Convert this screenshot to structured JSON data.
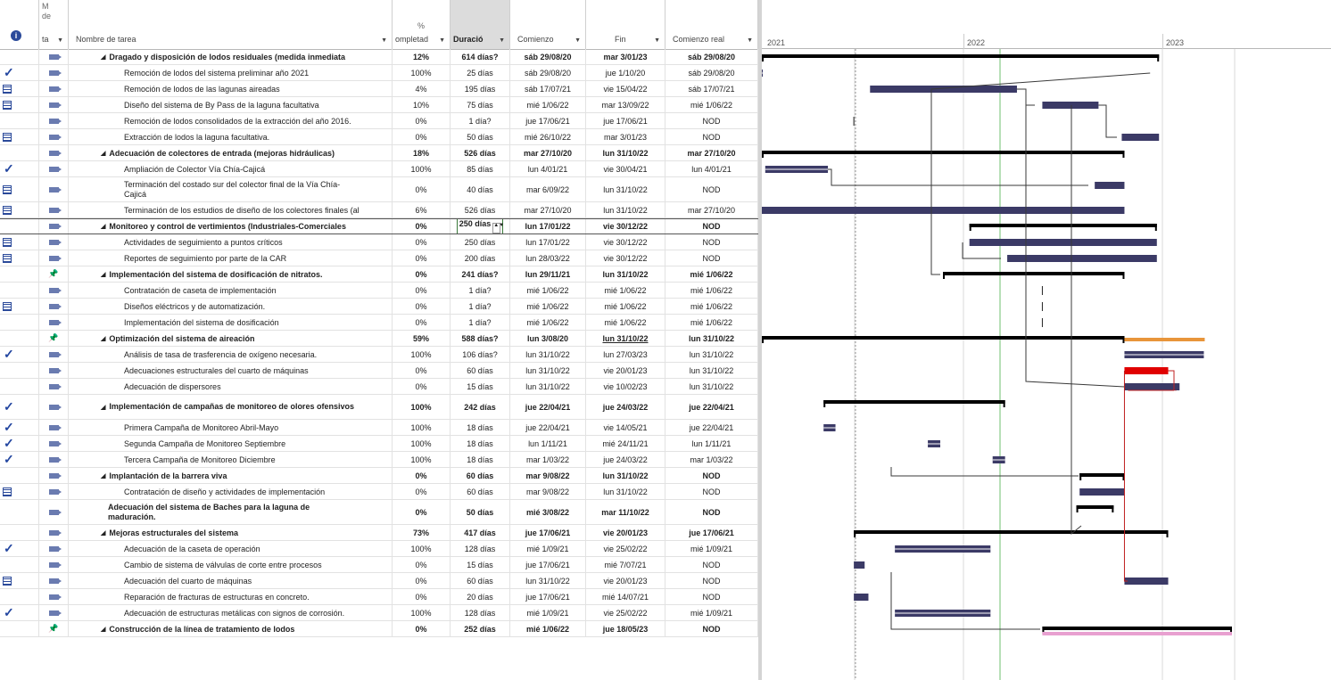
{
  "header": {
    "mode_top": "M",
    "mode_mid": "de",
    "mode_label": "ta",
    "name_label": "Nombre de tarea",
    "pct_top": "%",
    "pct_label": "ompletad",
    "dur_label": "Duració",
    "start_label": "Comienzo",
    "finish_label": "Fin",
    "real_start_label": "Comienzo real",
    "info_icon": "info-icon"
  },
  "timeline": {
    "years": [
      "2021",
      "2022",
      "2023"
    ]
  },
  "rows": [
    {
      "ind": "",
      "mode": "auto",
      "summary": true,
      "indent": 1,
      "name": "Dragado y disposición de lodos residuales (medida inmediata",
      "pct": "12%",
      "dur": "614 días?",
      "start": "sáb 29/08/20",
      "finish": "mar 3/01/23",
      "rstart": "sáb 29/08/20"
    },
    {
      "ind": "check",
      "mode": "auto",
      "summary": false,
      "indent": 2,
      "name": "Remoción de lodos del sistema preliminar año 2021",
      "pct": "100%",
      "dur": "25 días",
      "start": "sáb 29/08/20",
      "finish": "jue 1/10/20",
      "rstart": "sáb 29/08/20"
    },
    {
      "ind": "cal",
      "mode": "auto",
      "summary": false,
      "indent": 2,
      "name": "Remoción de lodos de las lagunas aireadas",
      "pct": "4%",
      "dur": "195 días",
      "start": "sáb 17/07/21",
      "finish": "vie 15/04/22",
      "rstart": "sáb 17/07/21"
    },
    {
      "ind": "cal",
      "mode": "auto",
      "summary": false,
      "indent": 2,
      "name": "Diseño del sistema de By Pass de la laguna facultativa",
      "pct": "10%",
      "dur": "75 días",
      "start": "mié 1/06/22",
      "finish": "mar 13/09/22",
      "rstart": "mié 1/06/22"
    },
    {
      "ind": "",
      "mode": "auto",
      "summary": false,
      "indent": 2,
      "name": "Remoción de lodos consolidados de la extracción del año 2016.",
      "pct": "0%",
      "dur": "1 día?",
      "start": "jue 17/06/21",
      "finish": "jue 17/06/21",
      "rstart": "NOD"
    },
    {
      "ind": "cal",
      "mode": "auto",
      "summary": false,
      "indent": 2,
      "name": "Extracción de lodos la laguna facultativa.",
      "pct": "0%",
      "dur": "50 días",
      "start": "mié 26/10/22",
      "finish": "mar 3/01/23",
      "rstart": "NOD"
    },
    {
      "ind": "",
      "mode": "auto",
      "summary": true,
      "indent": 1,
      "name": "Adecuación de colectores de entrada (mejoras hidráulicas)",
      "pct": "18%",
      "dur": "526 días",
      "start": "mar 27/10/20",
      "finish": "lun 31/10/22",
      "rstart": "mar 27/10/20"
    },
    {
      "ind": "check",
      "mode": "auto",
      "summary": false,
      "indent": 2,
      "name": "Ampliación de Colector Vía Chía-Cajicá",
      "pct": "100%",
      "dur": "85 días",
      "start": "lun 4/01/21",
      "finish": "vie 30/04/21",
      "rstart": "lun 4/01/21"
    },
    {
      "ind": "cal",
      "mode": "auto",
      "summary": false,
      "indent": 2,
      "tall": true,
      "name": "Terminación del costado sur del colector final de la Vía Chía-Cajicá",
      "pct": "0%",
      "dur": "40 días",
      "start": "mar 6/09/22",
      "finish": "lun 31/10/22",
      "rstart": "NOD"
    },
    {
      "ind": "cal",
      "mode": "auto",
      "summary": false,
      "indent": 2,
      "name": "Terminación de los estudios de diseño de los colectores finales (al",
      "pct": "6%",
      "dur": "526 días",
      "start": "mar 27/10/20",
      "finish": "lun 31/10/22",
      "rstart": "mar 27/10/20"
    },
    {
      "ind": "",
      "mode": "auto",
      "summary": true,
      "indent": 1,
      "editing": true,
      "name": "Monitoreo y control de vertimientos (Industriales-Comerciales",
      "pct": "0%",
      "dur": "250 días",
      "start": "lun 17/01/22",
      "finish": "vie 30/12/22",
      "rstart": "NOD"
    },
    {
      "ind": "cal",
      "mode": "auto",
      "summary": false,
      "indent": 2,
      "name": "Actividades de seguimiento a puntos críticos",
      "pct": "0%",
      "dur": "250 días",
      "start": "lun 17/01/22",
      "finish": "vie 30/12/22",
      "rstart": "NOD"
    },
    {
      "ind": "cal",
      "mode": "auto",
      "summary": false,
      "indent": 2,
      "name": "Reportes de seguimiento por parte de la CAR",
      "pct": "0%",
      "dur": "200 días",
      "start": "lun 28/03/22",
      "finish": "vie 30/12/22",
      "rstart": "NOD"
    },
    {
      "ind": "",
      "mode": "pin",
      "summary": true,
      "indent": 1,
      "name": "Implementación del sistema de dosificación de nitratos.",
      "pct": "0%",
      "dur": "241 días?",
      "start": "lun 29/11/21",
      "finish": "lun 31/10/22",
      "rstart": "mié 1/06/22"
    },
    {
      "ind": "",
      "mode": "auto",
      "summary": false,
      "indent": 2,
      "name": "Contratación de caseta de implementación",
      "pct": "0%",
      "dur": "1 día?",
      "start": "mié 1/06/22",
      "finish": "mié 1/06/22",
      "rstart": "mié 1/06/22"
    },
    {
      "ind": "cal",
      "mode": "auto",
      "summary": false,
      "indent": 2,
      "name": "Diseños eléctricos y de automatización.",
      "pct": "0%",
      "dur": "1 día?",
      "start": "mié 1/06/22",
      "finish": "mié 1/06/22",
      "rstart": "mié 1/06/22"
    },
    {
      "ind": "",
      "mode": "auto",
      "summary": false,
      "indent": 2,
      "name": "Implementación del sistema de dosificación",
      "pct": "0%",
      "dur": "1 día?",
      "start": "mié 1/06/22",
      "finish": "mié 1/06/22",
      "rstart": "mié 1/06/22"
    },
    {
      "ind": "",
      "mode": "pin",
      "summary": true,
      "indent": 1,
      "name": "Optimización del sistema de aireación",
      "pct": "59%",
      "dur": "588 días?",
      "start": "lun 3/08/20",
      "finish": "lun 31/10/22",
      "finish_underline": true,
      "rstart": "lun 31/10/22"
    },
    {
      "ind": "check",
      "mode": "auto",
      "summary": false,
      "indent": 2,
      "name": "Análisis de tasa de trasferencia de oxígeno necesaria.",
      "pct": "100%",
      "dur": "106 días?",
      "start": "lun 31/10/22",
      "finish": "lun 27/03/23",
      "rstart": "lun 31/10/22"
    },
    {
      "ind": "",
      "mode": "auto",
      "summary": false,
      "indent": 2,
      "name": "Adecuaciones estructurales del cuarto de máquinas",
      "pct": "0%",
      "dur": "60 días",
      "start": "lun 31/10/22",
      "finish": "vie 20/01/23",
      "rstart": "lun 31/10/22"
    },
    {
      "ind": "",
      "mode": "auto",
      "summary": false,
      "indent": 2,
      "name": "Adecuación de dispersores",
      "pct": "0%",
      "dur": "15 días",
      "start": "lun 31/10/22",
      "finish": "vie 10/02/23",
      "rstart": "lun 31/10/22"
    },
    {
      "ind": "check",
      "mode": "auto",
      "summary": true,
      "indent": 1,
      "tall": true,
      "name": "Implementación de campañas de monitoreo de olores ofensivos",
      "pct": "100%",
      "dur": "242 días",
      "start": "jue 22/04/21",
      "finish": "jue 24/03/22",
      "rstart": "jue 22/04/21"
    },
    {
      "ind": "check",
      "mode": "auto",
      "summary": false,
      "indent": 2,
      "name": "Primera Campaña de Monitoreo Abril-Mayo",
      "pct": "100%",
      "dur": "18 días",
      "start": "jue 22/04/21",
      "finish": "vie 14/05/21",
      "rstart": "jue 22/04/21"
    },
    {
      "ind": "check",
      "mode": "auto",
      "summary": false,
      "indent": 2,
      "name": "Segunda Campaña de Monitoreo Septiembre",
      "pct": "100%",
      "dur": "18 días",
      "start": "lun 1/11/21",
      "finish": "mié 24/11/21",
      "rstart": "lun 1/11/21"
    },
    {
      "ind": "check",
      "mode": "auto",
      "summary": false,
      "indent": 2,
      "name": "Tercera Campaña de Monitoreo Diciembre",
      "pct": "100%",
      "dur": "18 días",
      "start": "mar 1/03/22",
      "finish": "jue 24/03/22",
      "rstart": "mar 1/03/22"
    },
    {
      "ind": "",
      "mode": "auto",
      "summary": true,
      "indent": 1,
      "name": "Implantación de la barrera viva",
      "pct": "0%",
      "dur": "60 días",
      "start": "mar 9/08/22",
      "finish": "lun 31/10/22",
      "rstart": "NOD"
    },
    {
      "ind": "cal",
      "mode": "auto",
      "summary": false,
      "indent": 2,
      "name": "Contratación de diseño y actividades de implementación",
      "pct": "0%",
      "dur": "60 días",
      "start": "mar 9/08/22",
      "finish": "lun 31/10/22",
      "rstart": "NOD"
    },
    {
      "ind": "",
      "mode": "auto",
      "summary": true,
      "indent": 1,
      "notri": true,
      "tall": true,
      "name": "Adecuación del sistema de Baches para la laguna de maduración.",
      "pct": "0%",
      "dur": "50 días",
      "start": "mié 3/08/22",
      "finish": "mar 11/10/22",
      "rstart": "NOD"
    },
    {
      "ind": "",
      "mode": "auto",
      "summary": true,
      "indent": 1,
      "name": "Mejoras estructurales del sistema",
      "pct": "73%",
      "dur": "417 días",
      "start": "jue 17/06/21",
      "finish": "vie 20/01/23",
      "rstart": "jue 17/06/21"
    },
    {
      "ind": "check",
      "mode": "auto",
      "summary": false,
      "indent": 2,
      "name": "Adecuación de la caseta de operación",
      "pct": "100%",
      "dur": "128 días",
      "start": "mié 1/09/21",
      "finish": "vie 25/02/22",
      "rstart": "mié 1/09/21"
    },
    {
      "ind": "",
      "mode": "auto",
      "summary": false,
      "indent": 2,
      "name": "Cambio de sistema de válvulas de corte entre procesos",
      "pct": "0%",
      "dur": "15 días",
      "start": "jue 17/06/21",
      "finish": "mié 7/07/21",
      "rstart": "NOD"
    },
    {
      "ind": "cal",
      "mode": "auto",
      "summary": false,
      "indent": 2,
      "name": "Adecuación del cuarto de máquinas",
      "pct": "0%",
      "dur": "60 días",
      "start": "lun 31/10/22",
      "finish": "vie 20/01/23",
      "rstart": "NOD"
    },
    {
      "ind": "",
      "mode": "auto",
      "summary": false,
      "indent": 2,
      "name": "Reparación de fracturas de estructuras en concreto.",
      "pct": "0%",
      "dur": "20 días",
      "start": "jue 17/06/21",
      "finish": "mié 14/07/21",
      "rstart": "NOD"
    },
    {
      "ind": "check",
      "mode": "auto",
      "summary": false,
      "indent": 2,
      "name": "Adecuación de estructuras metálicas con signos de corrosión.",
      "pct": "100%",
      "dur": "128 días",
      "start": "mié 1/09/21",
      "finish": "vie 25/02/22",
      "rstart": "mié 1/09/21"
    },
    {
      "ind": "",
      "mode": "pin",
      "summary": true,
      "indent": 1,
      "name": "Construcción de la línea de tratamiento de lodos",
      "pct": "0%",
      "dur": "252 días",
      "start": "mié 1/06/22",
      "finish": "jue 18/05/23",
      "rstart": "NOD"
    }
  ],
  "colors": {
    "summary_bar": "#000000",
    "task_bar": "#3b3a66",
    "critical_bar": "#e00000",
    "critical_link": "#c02020",
    "progress_bar": "#e8953a",
    "pink_bar": "#e8a0d0",
    "today_line": "#6fbf6f",
    "link": "#3a3a3a"
  }
}
